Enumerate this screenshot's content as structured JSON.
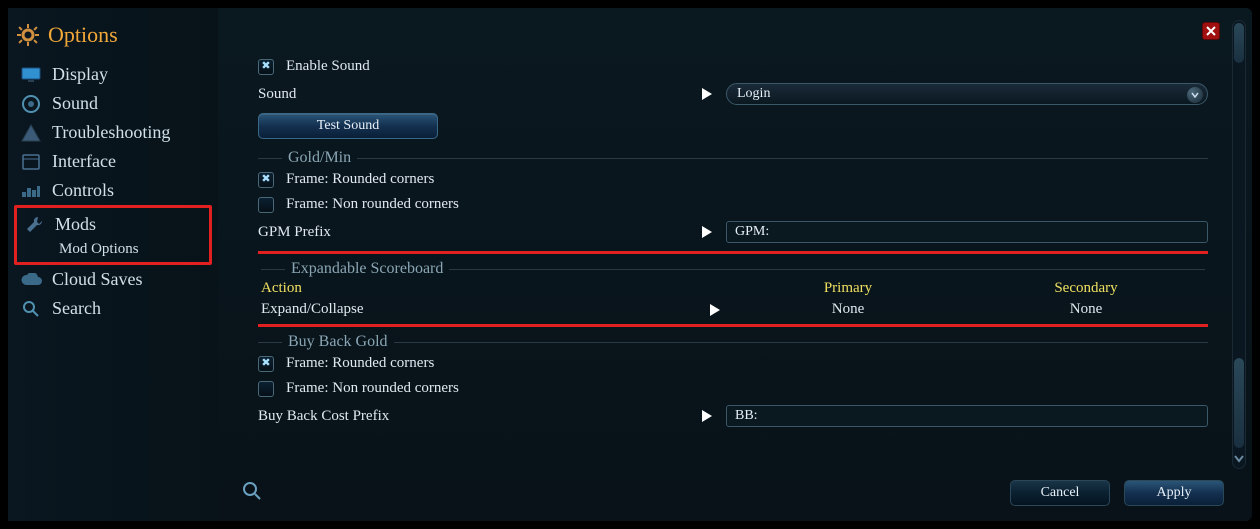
{
  "title": "Options",
  "sidebar": {
    "items": [
      {
        "label": "Display"
      },
      {
        "label": "Sound"
      },
      {
        "label": "Troubleshooting"
      },
      {
        "label": "Interface"
      },
      {
        "label": "Controls"
      },
      {
        "label": "Mods"
      },
      {
        "label": "Cloud Saves"
      },
      {
        "label": "Search"
      }
    ],
    "mods_sub": "Mod Options"
  },
  "sound": {
    "enable_label": "Enable Sound",
    "sound_label": "Sound",
    "test_btn": "Test Sound",
    "dropdown_value": "Login"
  },
  "gold": {
    "header": "Gold/Min",
    "rounded": "Frame: Rounded corners",
    "nonrounded": "Frame: Non rounded corners",
    "prefix_label": "GPM Prefix",
    "prefix_value": "GPM:"
  },
  "scoreboard": {
    "header": "Expandable Scoreboard",
    "action_h": "Action",
    "primary_h": "Primary",
    "secondary_h": "Secondary",
    "action": "Expand/Collapse",
    "primary": "None",
    "secondary": "None"
  },
  "buyback": {
    "header": "Buy Back Gold",
    "rounded": "Frame: Rounded corners",
    "nonrounded": "Frame: Non rounded corners",
    "prefix_label": "Buy Back Cost Prefix",
    "prefix_value": "BB:"
  },
  "footer": {
    "cancel": "Cancel",
    "apply": "Apply"
  }
}
